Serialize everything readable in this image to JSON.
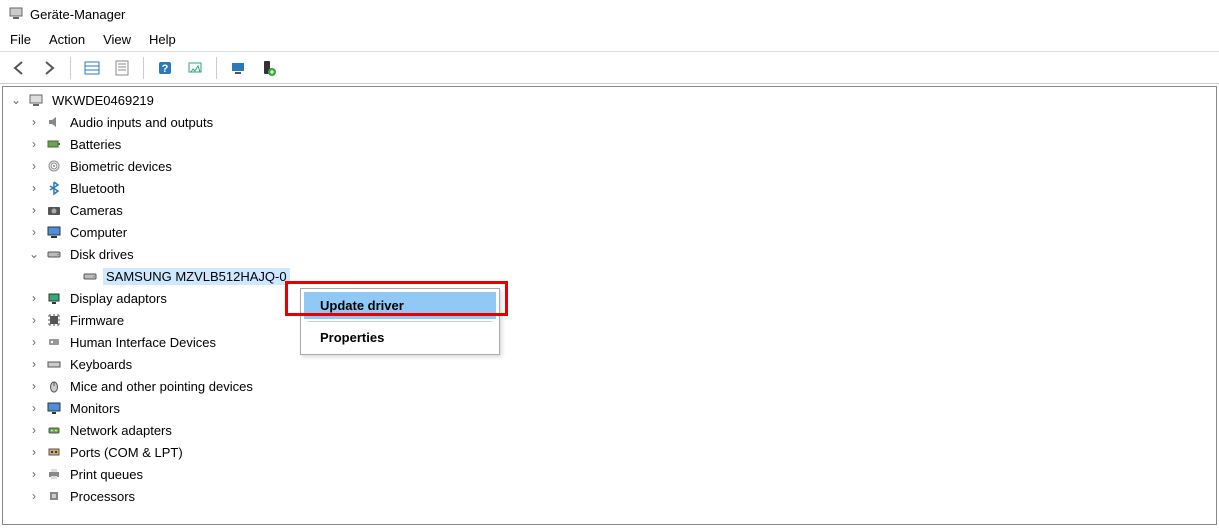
{
  "window": {
    "title": "Geräte-Manager"
  },
  "menubar": {
    "file": "File",
    "action": "Action",
    "view": "View",
    "help": "Help"
  },
  "toolbar_icons": [
    "back",
    "forward",
    "show-hidden",
    "properties-sheet",
    "help",
    "update",
    "monitor",
    "device-add"
  ],
  "tree": {
    "root": "WKWDE0469219",
    "categories": [
      {
        "label": "Audio inputs and outputs",
        "icon": "speaker"
      },
      {
        "label": "Batteries",
        "icon": "battery"
      },
      {
        "label": "Biometric devices",
        "icon": "fingerprint"
      },
      {
        "label": "Bluetooth",
        "icon": "bluetooth"
      },
      {
        "label": "Cameras",
        "icon": "camera"
      },
      {
        "label": "Computer",
        "icon": "computer"
      },
      {
        "label": "Disk drives",
        "icon": "disk",
        "expanded": true,
        "children": [
          {
            "label": "SAMSUNG MZVLB512HAJQ-0",
            "icon": "disk",
            "selected": true
          }
        ]
      },
      {
        "label": "Display adaptors",
        "icon": "display"
      },
      {
        "label": "Firmware",
        "icon": "firmware"
      },
      {
        "label": "Human Interface Devices",
        "icon": "hid"
      },
      {
        "label": "Keyboards",
        "icon": "keyboard"
      },
      {
        "label": "Mice and other pointing devices",
        "icon": "mouse"
      },
      {
        "label": "Monitors",
        "icon": "monitor"
      },
      {
        "label": "Network adapters",
        "icon": "network"
      },
      {
        "label": "Ports (COM & LPT)",
        "icon": "port"
      },
      {
        "label": "Print queues",
        "icon": "printer"
      },
      {
        "label": "Processors",
        "icon": "cpu"
      }
    ]
  },
  "context_menu": {
    "update_driver": "Update driver",
    "properties": "Properties"
  },
  "highlight_box": {
    "target": "update_driver"
  }
}
